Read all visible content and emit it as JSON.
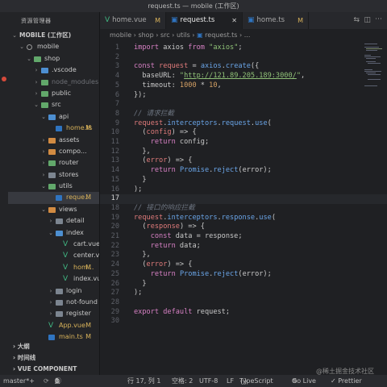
{
  "window": {
    "title": "request.ts — mobile (工作区)"
  },
  "colors": {
    "accent": "#6aa5e8",
    "modified": "#d8b25a",
    "error_underline": "#e0473a"
  },
  "sidebar": {
    "title": "资源管理器",
    "items": [
      {
        "label": "MOBILE (工作区)",
        "depth": 0,
        "chevron": "v",
        "icon": "none"
      },
      {
        "label": "mobile",
        "depth": 1,
        "chevron": "v",
        "icon": "circle"
      },
      {
        "label": "shop",
        "depth": 2,
        "chevron": "v",
        "icon": "folder-green"
      },
      {
        "label": ".vscode",
        "depth": 3,
        "chevron": ">",
        "icon": "folder-blue"
      },
      {
        "label": "node_modules",
        "depth": 3,
        "chevron": ">",
        "icon": "folder-green",
        "dim": true
      },
      {
        "label": "public",
        "depth": 3,
        "chevron": ">",
        "icon": "folder-green"
      },
      {
        "label": "src",
        "depth": 3,
        "chevron": "v",
        "icon": "folder-green"
      },
      {
        "label": "api",
        "depth": 4,
        "chevron": "v",
        "icon": "folder-blue"
      },
      {
        "label": "home.ts",
        "depth": 5,
        "chevron": "",
        "icon": "ts",
        "badge": "M"
      },
      {
        "label": "assets",
        "depth": 4,
        "chevron": ">",
        "icon": "folder-orange"
      },
      {
        "label": "compo...",
        "depth": 4,
        "chevron": ">",
        "icon": "folder-orange"
      },
      {
        "label": "router",
        "depth": 4,
        "chevron": ">",
        "icon": "folder-green"
      },
      {
        "label": "stores",
        "depth": 4,
        "chevron": ">",
        "icon": "folder-grey"
      },
      {
        "label": "utils",
        "depth": 4,
        "chevron": "v",
        "icon": "folder-green"
      },
      {
        "label": "reque...",
        "depth": 5,
        "chevron": "",
        "icon": "ts",
        "badge": "M",
        "active": true
      },
      {
        "label": "views",
        "depth": 4,
        "chevron": "v",
        "icon": "folder-orange"
      },
      {
        "label": "detail",
        "depth": 5,
        "chevron": ">",
        "icon": "folder-grey"
      },
      {
        "label": "index",
        "depth": 5,
        "chevron": "v",
        "icon": "folder-blue"
      },
      {
        "label": "cart.vue",
        "depth": 6,
        "chevron": "",
        "icon": "vue"
      },
      {
        "label": "center.vue",
        "depth": 6,
        "chevron": "",
        "icon": "vue"
      },
      {
        "label": "hom...",
        "depth": 6,
        "chevron": "",
        "icon": "vue",
        "badge": "M"
      },
      {
        "label": "index.vue",
        "depth": 6,
        "chevron": "",
        "icon": "vue"
      },
      {
        "label": "login",
        "depth": 5,
        "chevron": ">",
        "icon": "folder-grey"
      },
      {
        "label": "not-found",
        "depth": 5,
        "chevron": ">",
        "icon": "folder-grey"
      },
      {
        "label": "register",
        "depth": 5,
        "chevron": ">",
        "icon": "folder-grey"
      },
      {
        "label": "App.vue",
        "depth": 4,
        "chevron": "",
        "icon": "vue",
        "badge": "M"
      },
      {
        "label": "main.ts",
        "depth": 4,
        "chevron": "",
        "icon": "ts",
        "badge": "M"
      }
    ],
    "sections": [
      {
        "label": "大纲"
      },
      {
        "label": "时间线"
      },
      {
        "label": "VUE COMPONENT PREVI..."
      }
    ]
  },
  "tabs": [
    {
      "label": "home.vue",
      "mark": "M",
      "icon": "vue",
      "active": false
    },
    {
      "label": "request.ts",
      "mark": "✕",
      "icon": "ts",
      "active": true
    },
    {
      "label": "home.ts",
      "mark": "M",
      "icon": "ts",
      "active": false
    }
  ],
  "breadcrumb": [
    "mobile",
    "shop",
    "src",
    "utils",
    "request.ts",
    "..."
  ],
  "code": [
    {
      "n": "1",
      "t": [
        [
          "kw",
          "import"
        ],
        [
          "pl",
          " axios "
        ],
        [
          "kw",
          "from"
        ],
        [
          "pl",
          " "
        ],
        [
          "str",
          "\"axios\""
        ],
        [
          "pl",
          ";"
        ]
      ]
    },
    {
      "n": "2",
      "t": []
    },
    {
      "n": "3",
      "t": [
        [
          "kw",
          "const"
        ],
        [
          "pl",
          " "
        ],
        [
          "var",
          "request"
        ],
        [
          "pl",
          " = "
        ],
        [
          "fn",
          "axios"
        ],
        [
          "pl",
          "."
        ],
        [
          "fn",
          "create"
        ],
        [
          "pl",
          "({"
        ]
      ]
    },
    {
      "n": "4",
      "t": [
        [
          "pl",
          "  baseURL: "
        ],
        [
          "str",
          "\""
        ],
        [
          "link",
          "http://121.89.205.189:3000/"
        ],
        [
          "str",
          "\""
        ],
        [
          "pl",
          ","
        ]
      ]
    },
    {
      "n": "5",
      "t": [
        [
          "pl",
          "  timeout: "
        ],
        [
          "num",
          "1000"
        ],
        [
          "pl",
          " * "
        ],
        [
          "num",
          "10"
        ],
        [
          "pl",
          ","
        ]
      ]
    },
    {
      "n": "6",
      "t": [
        [
          "pl",
          "});"
        ]
      ]
    },
    {
      "n": "7",
      "t": []
    },
    {
      "n": "8",
      "t": [
        [
          "cm",
          "// 请求拦截"
        ]
      ]
    },
    {
      "n": "9",
      "t": [
        [
          "var",
          "request"
        ],
        [
          "pl",
          "."
        ],
        [
          "bl",
          "interceptors"
        ],
        [
          "pl",
          "."
        ],
        [
          "bl",
          "request"
        ],
        [
          "pl",
          "."
        ],
        [
          "fn",
          "use"
        ],
        [
          "pl",
          "("
        ]
      ]
    },
    {
      "n": "10",
      "t": [
        [
          "pl",
          "  ("
        ],
        [
          "var",
          "config"
        ],
        [
          "pl",
          ") => {"
        ]
      ]
    },
    {
      "n": "11",
      "t": [
        [
          "pl",
          "    "
        ],
        [
          "kw",
          "return"
        ],
        [
          "pl",
          " config;"
        ]
      ]
    },
    {
      "n": "12",
      "t": [
        [
          "pl",
          "  },"
        ]
      ]
    },
    {
      "n": "13",
      "t": [
        [
          "pl",
          "  ("
        ],
        [
          "var",
          "error"
        ],
        [
          "pl",
          ") => {"
        ]
      ]
    },
    {
      "n": "14",
      "t": [
        [
          "pl",
          "    "
        ],
        [
          "kw",
          "return"
        ],
        [
          "pl",
          " "
        ],
        [
          "fn",
          "Promise"
        ],
        [
          "pl",
          "."
        ],
        [
          "fn",
          "reject"
        ],
        [
          "pl",
          "(error);"
        ]
      ]
    },
    {
      "n": "15",
      "t": [
        [
          "pl",
          "  }"
        ]
      ]
    },
    {
      "n": "16",
      "t": [
        [
          "pl",
          ");"
        ]
      ]
    },
    {
      "n": "17",
      "t": []
    },
    {
      "n": "18",
      "t": [
        [
          "cm",
          "// 接口的响应拦截"
        ]
      ]
    },
    {
      "n": "19",
      "t": [
        [
          "var",
          "request"
        ],
        [
          "pl",
          "."
        ],
        [
          "bl",
          "interceptors"
        ],
        [
          "pl",
          "."
        ],
        [
          "bl",
          "response"
        ],
        [
          "pl",
          "."
        ],
        [
          "fn",
          "use"
        ],
        [
          "pl",
          "("
        ]
      ]
    },
    {
      "n": "20",
      "t": [
        [
          "pl",
          "  ("
        ],
        [
          "var",
          "response"
        ],
        [
          "pl",
          ") => {"
        ]
      ]
    },
    {
      "n": "21",
      "t": [
        [
          "pl",
          "    "
        ],
        [
          "kw",
          "const"
        ],
        [
          "pl",
          " data = response;"
        ]
      ]
    },
    {
      "n": "22",
      "t": [
        [
          "pl",
          "    "
        ],
        [
          "kw",
          "return"
        ],
        [
          "pl",
          " data;"
        ]
      ]
    },
    {
      "n": "23",
      "t": [
        [
          "pl",
          "  },"
        ]
      ]
    },
    {
      "n": "24",
      "t": [
        [
          "pl",
          "  ("
        ],
        [
          "var",
          "error"
        ],
        [
          "pl",
          ") => {"
        ]
      ]
    },
    {
      "n": "25",
      "t": [
        [
          "pl",
          "    "
        ],
        [
          "kw",
          "return"
        ],
        [
          "pl",
          " "
        ],
        [
          "fn",
          "Promise"
        ],
        [
          "pl",
          "."
        ],
        [
          "fn",
          "reject"
        ],
        [
          "pl",
          "(error);"
        ]
      ]
    },
    {
      "n": "26",
      "t": [
        [
          "pl",
          "  }"
        ]
      ]
    },
    {
      "n": "27",
      "t": [
        [
          "pl",
          ");"
        ]
      ]
    },
    {
      "n": "28",
      "t": []
    },
    {
      "n": "29",
      "t": [
        [
          "kw",
          "export"
        ],
        [
          "pl",
          " "
        ],
        [
          "kw",
          "default"
        ],
        [
          "pl",
          " request;"
        ]
      ]
    },
    {
      "n": "30",
      "t": []
    }
  ],
  "cursor_line": "17",
  "statusbar": {
    "branch": "master*+",
    "errors": "0",
    "warnings": "0",
    "info": "0",
    "position": "行 17, 列 1",
    "spaces": "空格: 2",
    "encoding": "UTF-8",
    "eol": "LF",
    "language": "TypeScript",
    "golive": "Go Live",
    "prettier": "✓ Prettier",
    "watermark": "@稀土掘金技术社区"
  }
}
